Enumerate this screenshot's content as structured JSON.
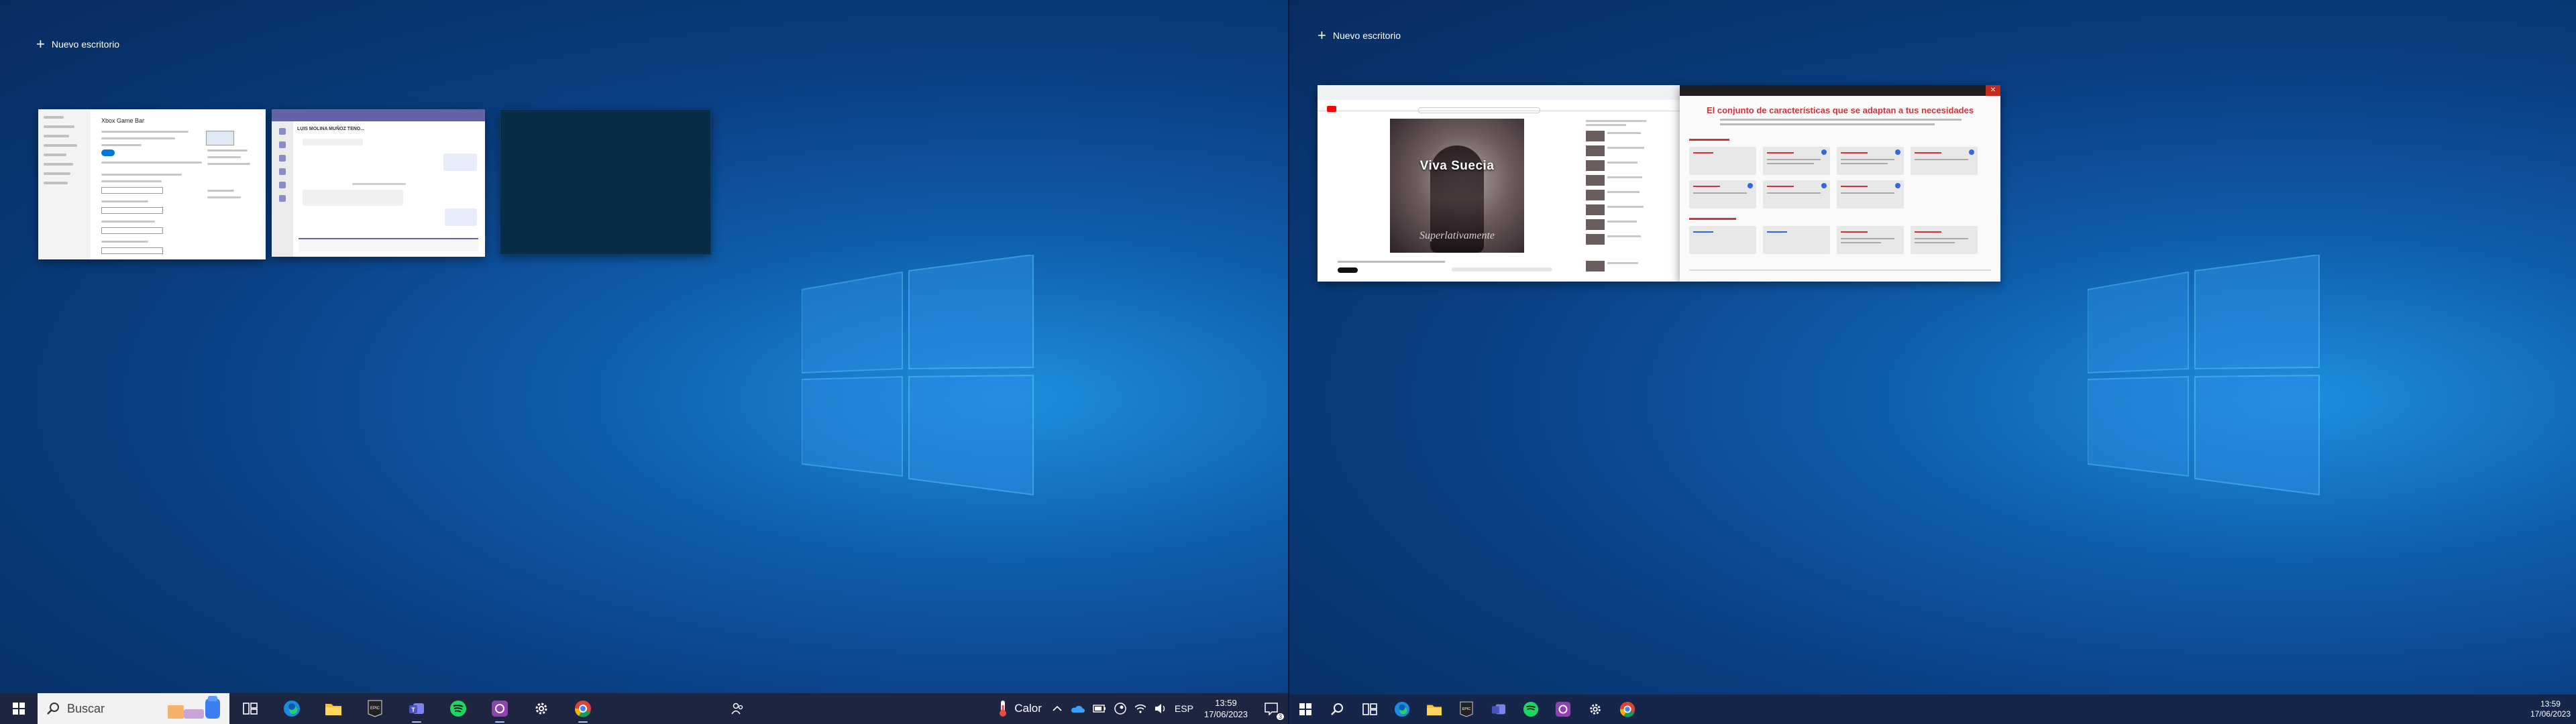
{
  "left_screen": {
    "new_desktop_label": "Nuevo escritorio",
    "windows": [
      {
        "title": "Xbox Game Bar"
      },
      {
        "title": "LUIS MOLINA MUÑOZ TENO..."
      },
      {
        "title": ""
      }
    ],
    "taskbar": {
      "search_label": "Buscar",
      "apps": [
        "task-view",
        "edge",
        "file-explorer",
        "epic-games",
        "teams",
        "spotify",
        "app-purple",
        "settings",
        "chrome"
      ],
      "weather_label": "Calor",
      "language": "ESP",
      "time": "13:59",
      "date": "17/06/2023",
      "notification_count": "3"
    }
  },
  "right_screen": {
    "new_desktop_label": "Nuevo escritorio",
    "video_window": {
      "video_title": "Viva Suecia",
      "video_subtitle": "Superlativamente"
    },
    "features_window": {
      "title": "El conjunto de características que se adaptan a tus necesidades"
    },
    "taskbar": {
      "time": "13:59",
      "date": "17/06/2023"
    }
  }
}
